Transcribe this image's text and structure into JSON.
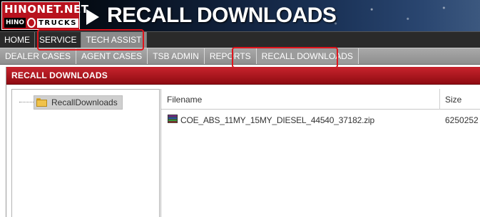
{
  "banner": {
    "logo_top": "HINONET.NET",
    "logo_hino": "HINO",
    "logo_trucks": "TRUCKS",
    "title": "RECALL DOWNLOADS"
  },
  "main_nav": [
    {
      "label": "HOME",
      "active": false
    },
    {
      "label": "SERVICE",
      "active": false
    },
    {
      "label": "TECH ASSIST",
      "active": true
    }
  ],
  "sub_nav": [
    {
      "label": "DEALER CASES",
      "active": false
    },
    {
      "label": "AGENT CASES",
      "active": false
    },
    {
      "label": "TSB ADMIN",
      "active": false
    },
    {
      "label": "REPORTS",
      "active": false
    },
    {
      "label": "RECALL DOWNLOADS",
      "active": true
    }
  ],
  "panel": {
    "header": "RECALL DOWNLOADS",
    "tree": {
      "root_label": "RecallDownloads",
      "root_icon": "folder-icon"
    },
    "files": {
      "columns": {
        "filename": "Filename",
        "size": "Size"
      },
      "rows": [
        {
          "icon": "zip-archive-icon",
          "filename": "COE_ABS_11MY_15MY_DIESEL_44540_37182.zip",
          "size": "6250252"
        }
      ]
    }
  },
  "colors": {
    "brand_red": "#b8121d",
    "panel_header_red": "#c8242d",
    "highlight_red": "#e0141c",
    "main_nav_bg": "#2a2a2a",
    "sub_nav_bg": "#a9a9a9"
  }
}
